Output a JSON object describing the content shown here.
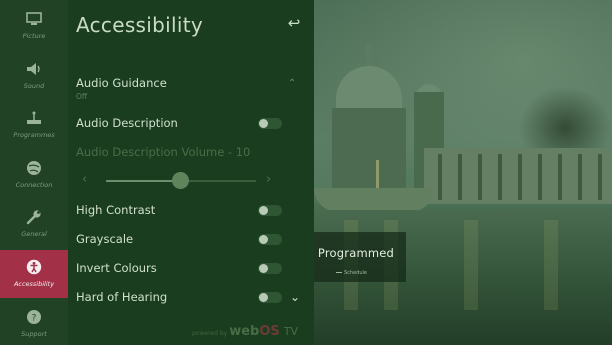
{
  "rail": {
    "items": [
      {
        "label": "Picture",
        "icon": "picture-icon"
      },
      {
        "label": "Sound",
        "icon": "speaker-icon"
      },
      {
        "label": "Programmes",
        "icon": "antenna-icon"
      },
      {
        "label": "Connection",
        "icon": "globe-icon"
      },
      {
        "label": "General",
        "icon": "wrench-icon"
      },
      {
        "label": "Accessibility",
        "icon": "accessibility-icon",
        "active": true
      },
      {
        "label": "Support",
        "icon": "support-icon"
      }
    ]
  },
  "panel": {
    "title": "Accessibility",
    "back_icon": "back-arrow-icon",
    "audio_guidance": {
      "label": "Audio Guidance",
      "value": "Off"
    },
    "audio_description": {
      "label": "Audio Description",
      "on": false
    },
    "audio_description_volume": {
      "label": "Audio Description Volume - 10",
      "value": 10,
      "max": 20
    },
    "high_contrast": {
      "label": "High Contrast",
      "on": false
    },
    "grayscale": {
      "label": "Grayscale",
      "on": false
    },
    "invert_colours": {
      "label": "Invert Colours",
      "on": false
    },
    "hard_of_hearing": {
      "label": "Hard of Hearing",
      "on": false
    },
    "powered_by": {
      "prefix": "powered by",
      "brand_web": "web",
      "brand_os": "OS",
      "brand_tv": "TV"
    }
  },
  "overlay": {
    "title": ": Programmed",
    "subtitle": "Schedule"
  },
  "colors": {
    "active_accent": "#a23147",
    "panel_bg": "#1b3d1f",
    "rail_bg": "#214225"
  }
}
